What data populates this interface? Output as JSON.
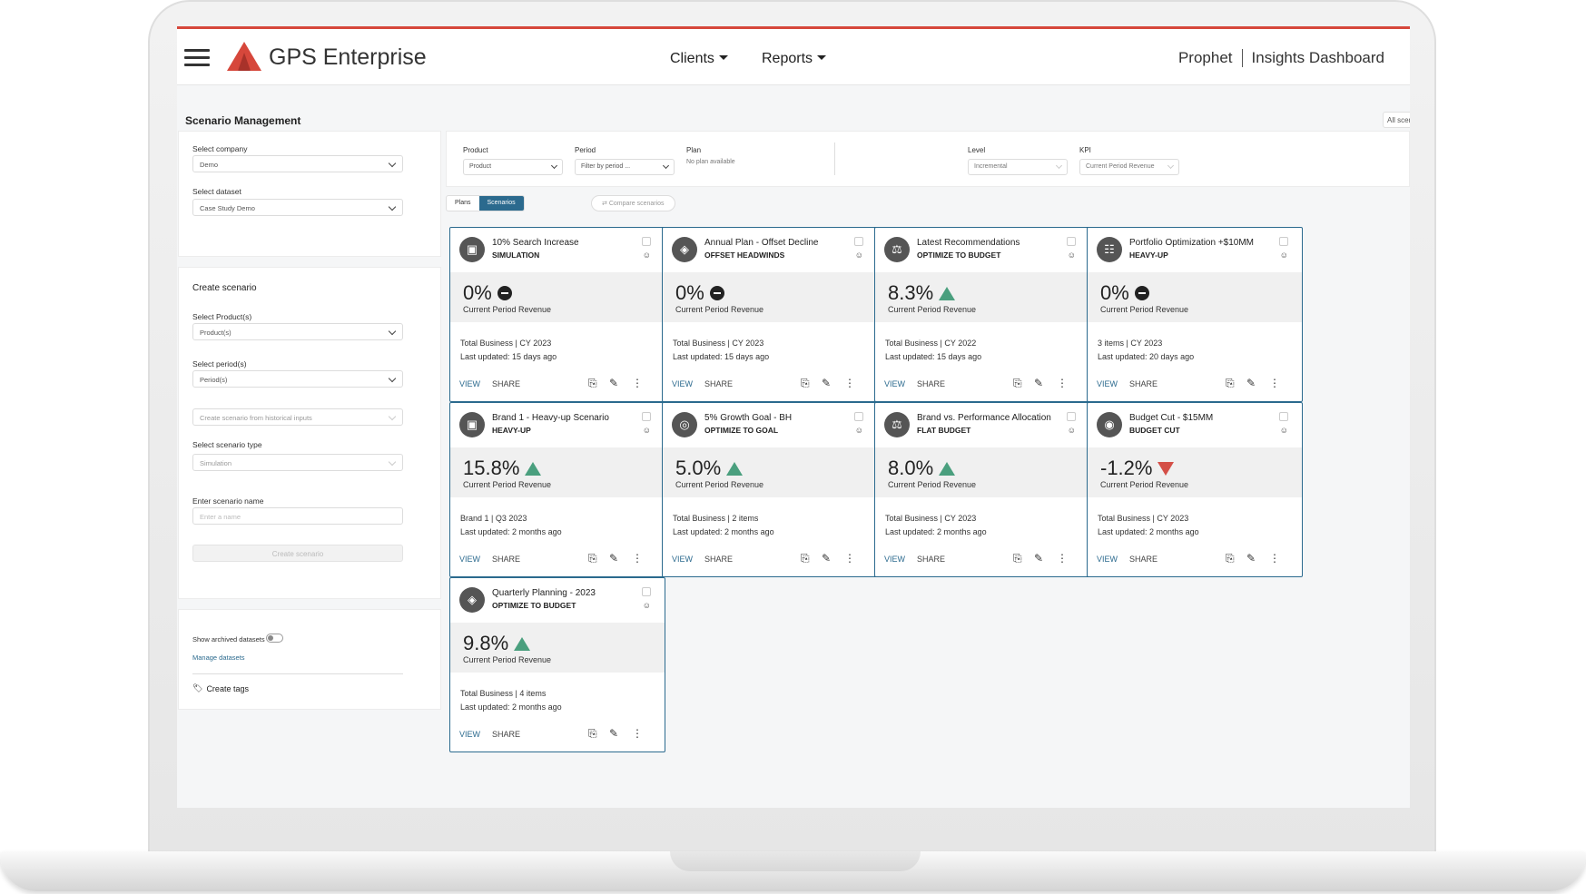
{
  "header": {
    "brand": "GPS Enterprise",
    "nav": [
      "Clients",
      "Reports"
    ],
    "right_links": [
      "Prophet",
      "Insights Dashboard"
    ],
    "accent": "#d6473b"
  },
  "page": {
    "title": "Scenario Management",
    "all_scenarios": "All scenarios"
  },
  "sidebar": {
    "company_label": "Select company",
    "company_value": "Demo",
    "dataset_label": "Select dataset",
    "dataset_value": "Case Study Demo",
    "create_heading": "Create scenario",
    "products_label": "Select Product(s)",
    "products_value": "Product(s)",
    "periods_label": "Select period(s)",
    "periods_value": "Period(s)",
    "historical_value": "Create scenario from historical inputs",
    "type_label": "Select scenario type",
    "type_value": "Simulation",
    "name_label": "Enter scenario name",
    "name_placeholder": "Enter a name",
    "create_button": "Create scenario",
    "archived_label": "Show archived datasets",
    "manage_link": "Manage datasets",
    "tags_link": "Create tags"
  },
  "filters": {
    "product_label": "Product",
    "product_value": "Product",
    "period_label": "Period",
    "period_value": "Filter by period ...",
    "plan_label": "Plan",
    "plan_value": "No plan available",
    "level_label": "Level",
    "level_value": "Incremental",
    "kpi_label": "KPI",
    "kpi_value": "Current Period Revenue"
  },
  "tabs": [
    "Plans",
    "Scenarios"
  ],
  "compare_label": "Compare scenarios",
  "card_actions": {
    "view": "VIEW",
    "share": "SHARE"
  },
  "colors": {
    "primary": "#2b6a8e",
    "up": "#4a9f7e",
    "down": "#d44f47"
  },
  "cards": [
    {
      "title": "10% Search Increase",
      "type": "SIMULATION",
      "value": "0%",
      "trend": "neutral",
      "kpi": "Current Period Revenue",
      "meta1": "Total Business | CY 2023",
      "meta2": "Last updated: 15 days ago"
    },
    {
      "title": "Annual Plan - Offset Decline",
      "type": "OFFSET HEADWINDS",
      "value": "0%",
      "trend": "neutral",
      "kpi": "Current Period Revenue",
      "meta1": "Total Business | CY 2023",
      "meta2": "Last updated: 15 days ago"
    },
    {
      "title": "Latest Recommendations",
      "type": "OPTIMIZE TO BUDGET",
      "value": "8.3%",
      "trend": "up",
      "kpi": "Current Period Revenue",
      "meta1": "Total Business | CY 2022",
      "meta2": "Last updated: 15 days ago"
    },
    {
      "title": "Portfolio Optimization +$10MM",
      "type": "HEAVY-UP",
      "value": "0%",
      "trend": "neutral",
      "kpi": "Current Period Revenue",
      "meta1": "3 items | CY 2023",
      "meta2": "Last updated: 20 days ago"
    },
    {
      "title": "Brand 1 - Heavy-up Scenario",
      "type": "HEAVY-UP",
      "value": "15.8%",
      "trend": "up",
      "kpi": "Current Period Revenue",
      "meta1": "Brand 1 | Q3 2023",
      "meta2": "Last updated: 2 months ago"
    },
    {
      "title": "5% Growth Goal - BH",
      "type": "OPTIMIZE TO GOAL",
      "value": "5.0%",
      "trend": "up",
      "kpi": "Current Period Revenue",
      "meta1": "Total Business | 2 items",
      "meta2": "Last updated: 2 months ago"
    },
    {
      "title": "Brand vs. Performance Allocation",
      "type": "FLAT BUDGET",
      "value": "8.0%",
      "trend": "up",
      "kpi": "Current Period Revenue",
      "meta1": "Total Business | CY 2023",
      "meta2": "Last updated: 2 months ago"
    },
    {
      "title": "Budget Cut - $15MM",
      "type": "BUDGET CUT",
      "value": "-1.2%",
      "trend": "down",
      "kpi": "Current Period Revenue",
      "meta1": "Total Business | CY 2023",
      "meta2": "Last updated: 2 months ago"
    },
    {
      "title": "Quarterly Planning - 2023",
      "type": "OPTIMIZE TO BUDGET",
      "value": "9.8%",
      "trend": "up",
      "kpi": "Current Period Revenue",
      "meta1": "Total Business | 4 items",
      "meta2": "Last updated: 2 months ago"
    }
  ]
}
